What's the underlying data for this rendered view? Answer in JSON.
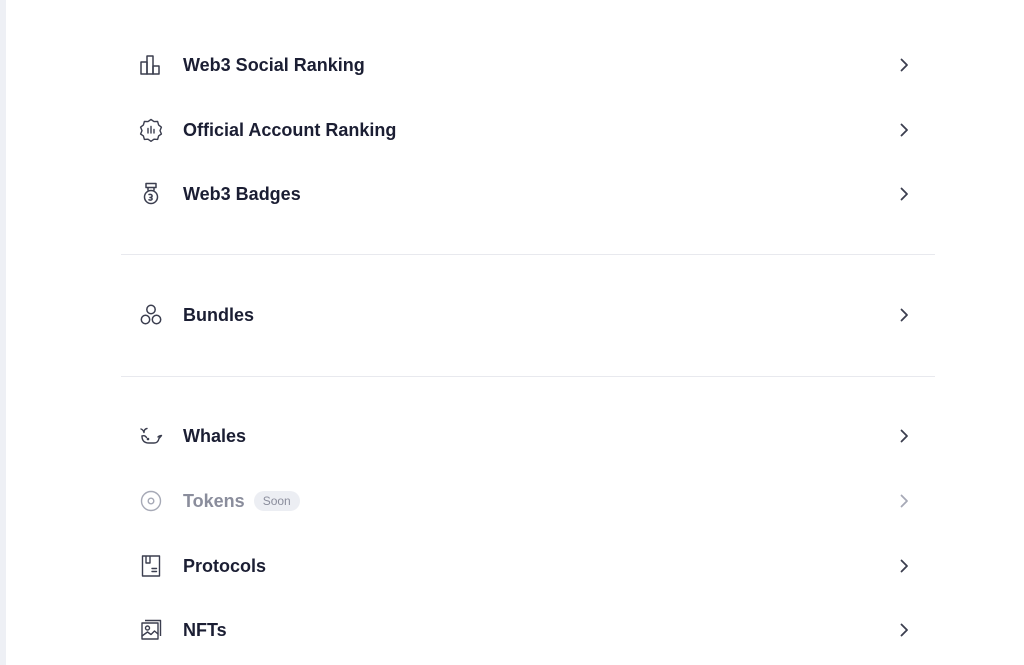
{
  "menu": {
    "sections": [
      {
        "items": [
          {
            "label": "Web3 Social Ranking",
            "icon": "bar-chart-icon"
          },
          {
            "label": "Official Account Ranking",
            "icon": "verified-badge-icon"
          },
          {
            "label": "Web3 Badges",
            "icon": "medal-icon"
          }
        ]
      },
      {
        "items": [
          {
            "label": "Bundles",
            "icon": "bundles-icon"
          }
        ]
      },
      {
        "items": [
          {
            "label": "Whales",
            "icon": "whale-icon"
          },
          {
            "label": "Tokens",
            "icon": "token-icon",
            "badge": "Soon",
            "disabled": true
          },
          {
            "label": "Protocols",
            "icon": "protocol-icon"
          },
          {
            "label": "NFTs",
            "icon": "nft-icon"
          }
        ]
      }
    ]
  },
  "colors": {
    "text": "#1b1e33",
    "muted": "#8a8d9c",
    "divider": "#e8e9ee",
    "badge_bg": "#eceef3"
  }
}
